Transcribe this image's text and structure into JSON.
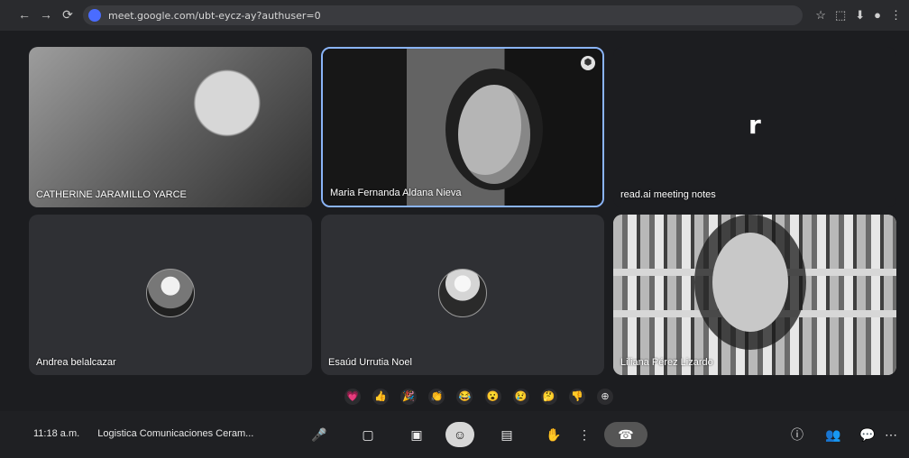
{
  "browser": {
    "url": "meet.google.com/ubt-eycz-ay?authuser=0",
    "nav": [
      "←",
      "→",
      "⟳"
    ],
    "right_icons": [
      "☆",
      "⬚",
      "⬇",
      "●",
      "⋮"
    ]
  },
  "participants": [
    {
      "name": "CATHERINE JARAMILLO YARCE"
    },
    {
      "name": "Maria Fernanda Aldana Nieva"
    },
    {
      "name": "read.ai meeting notes",
      "letter": "r"
    },
    {
      "name": "Andrea belalcazar"
    },
    {
      "name": "Esaúd Urrutia Noel"
    },
    {
      "name": "Liliana Pérez Lizardo"
    }
  ],
  "reactions": [
    "💗",
    "👍",
    "🎉",
    "👏",
    "😂",
    "😮",
    "😢",
    "🤔",
    "👎",
    "⊕"
  ],
  "bottom": {
    "time": "11:18 a.m.",
    "meeting_title": "Logistica Comunicaciones Ceram...",
    "controls": [
      "🎤",
      "▢",
      "▣",
      "☺",
      "▤",
      "✋",
      "⋮",
      "☎"
    ],
    "right_icons": [
      "ⓘ",
      "👥",
      "💬",
      "⋯"
    ]
  }
}
